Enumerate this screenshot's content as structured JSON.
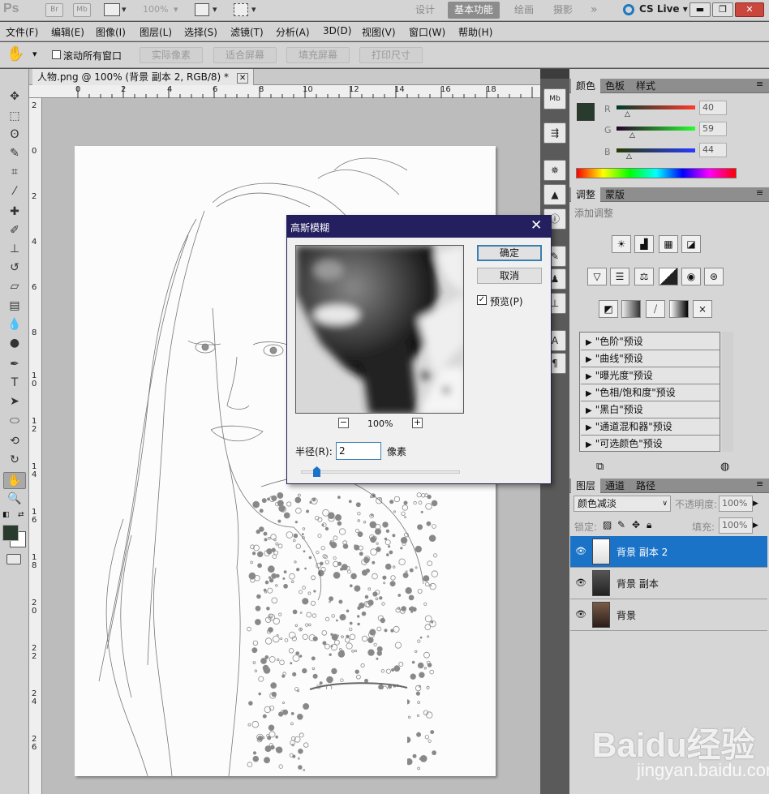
{
  "appbar": {
    "logo": "Ps",
    "btn_br": "Br",
    "btn_mb": "Mb",
    "zoom": "100%",
    "workspaces": [
      "设计",
      "基本功能",
      "绘画",
      "摄影"
    ],
    "more": "»",
    "cslive": "CS Live ▾"
  },
  "menu": [
    "文件(F)",
    "编辑(E)",
    "图像(I)",
    "图层(L)",
    "选择(S)",
    "滤镜(T)",
    "分析(A)",
    "3D(D)",
    "视图(V)",
    "窗口(W)",
    "帮助(H)"
  ],
  "options": {
    "scroll_all": "滚动所有窗口",
    "buttons": [
      "实际像素",
      "适合屏幕",
      "填充屏幕",
      "打印尺寸"
    ]
  },
  "document": {
    "tab_title": "人物.png @ 100% (背景 副本 2, RGB/8) *",
    "ruler_h": [
      "0",
      "2",
      "4",
      "6",
      "8",
      "10",
      "12",
      "14",
      "16",
      "18"
    ],
    "ruler_v": [
      "2",
      "0",
      "2",
      "4",
      "6",
      "8",
      "1\n0",
      "1\n2",
      "1\n4",
      "1\n6",
      "1\n8",
      "2\n0",
      "2\n2",
      "2\n4",
      "2\n6"
    ]
  },
  "color_panel": {
    "tabs": [
      "颜色",
      "色板",
      "样式"
    ],
    "r_label": "R",
    "g_label": "G",
    "b_label": "B",
    "r": "40",
    "g": "59",
    "b": "44",
    "fg_color": "#283b2c"
  },
  "adjust_panel": {
    "tabs": [
      "调整",
      "蒙版"
    ],
    "title": "添加调整",
    "presets": [
      "\"色阶\"预设",
      "\"曲线\"预设",
      "\"曝光度\"预设",
      "\"色相/饱和度\"预设",
      "\"黑白\"预设",
      "\"通道混和器\"预设",
      "\"可选颜色\"预设"
    ]
  },
  "layers_panel": {
    "tabs": [
      "图层",
      "通道",
      "路径"
    ],
    "blend_mode": "颜色减淡",
    "opacity_label": "不透明度:",
    "opacity": "100%",
    "lock_label": "锁定:",
    "fill_label": "填充:",
    "fill": "100%",
    "layers": [
      {
        "name": "背景 副本 2",
        "selected": true
      },
      {
        "name": "背景 副本",
        "selected": false
      },
      {
        "name": "背景",
        "selected": false
      }
    ]
  },
  "dialog": {
    "title": "高斯模糊",
    "ok": "确定",
    "cancel": "取消",
    "preview_label": "预览(P)",
    "preview_checked": true,
    "zoom": "100%",
    "radius_label": "半径(R):",
    "radius": "2",
    "unit": "像素"
  },
  "watermark": {
    "main": "Baidu经验",
    "sub": "jingyan.baidu.com"
  }
}
